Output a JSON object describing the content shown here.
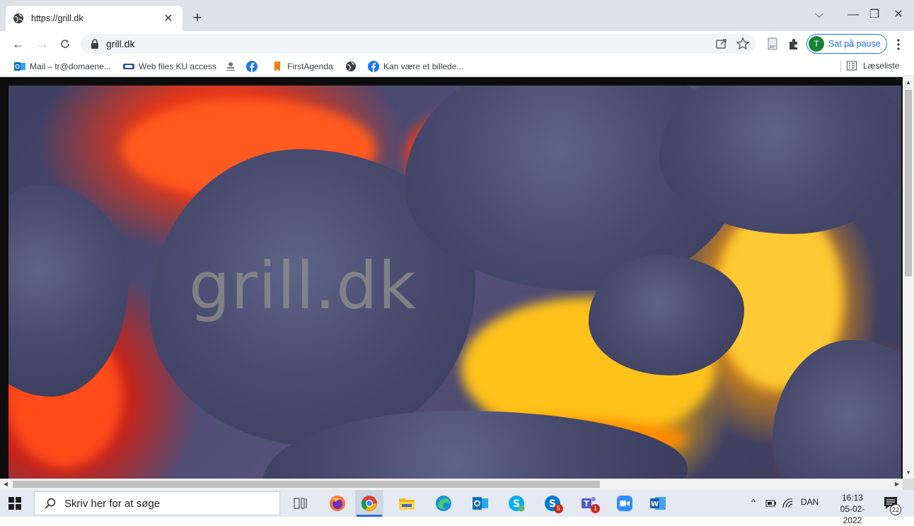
{
  "browser": {
    "tab": {
      "title": "https://grill.dk",
      "favicon": "globe-icon"
    },
    "new_tab": "+",
    "window_controls": {
      "dropdown": "⌵",
      "minimize": "—",
      "restore": "❐",
      "close": "✕"
    },
    "omnibox": {
      "url": "grill.dk"
    },
    "profile": {
      "initial": "T",
      "label": "Sat på pause",
      "color": "#188038"
    },
    "bookmarks": [
      {
        "label": "Mail – tr@domaene...",
        "icon": "outlook-icon"
      },
      {
        "label": "Web files KU access",
        "icon": "ku-icon"
      },
      {
        "label": "",
        "icon": "crest-icon"
      },
      {
        "label": "",
        "icon": "facebook-icon"
      },
      {
        "label": "FirstAgenda",
        "icon": "firstagenda-icon"
      },
      {
        "label": "",
        "icon": "globe-icon"
      },
      {
        "label": "Kan være et billede...",
        "icon": "facebook-icon"
      }
    ],
    "reading_list": "Læseliste"
  },
  "page": {
    "hero_title": "grill.dk",
    "background": "glowing lava / embers"
  },
  "taskbar": {
    "search_placeholder": "Skriv her for at søge",
    "apps": [
      "task-view",
      "firefox",
      "chrome",
      "file-explorer",
      "edge",
      "outlook",
      "skype",
      "skype-for-business",
      "teams",
      "zoom",
      "word"
    ],
    "badges": {
      "skype-for-business": "5",
      "teams": "1"
    },
    "tray": {
      "chevron": "^",
      "language": "DAN"
    },
    "clock": {
      "time": "16:13",
      "date": "05-02-2022"
    },
    "notifications": "22"
  },
  "colors": {
    "accent": "#1a73e8",
    "lava_yellow": "#ffd54a",
    "lava_red": "#e2361a",
    "rock": "#484b6e"
  }
}
